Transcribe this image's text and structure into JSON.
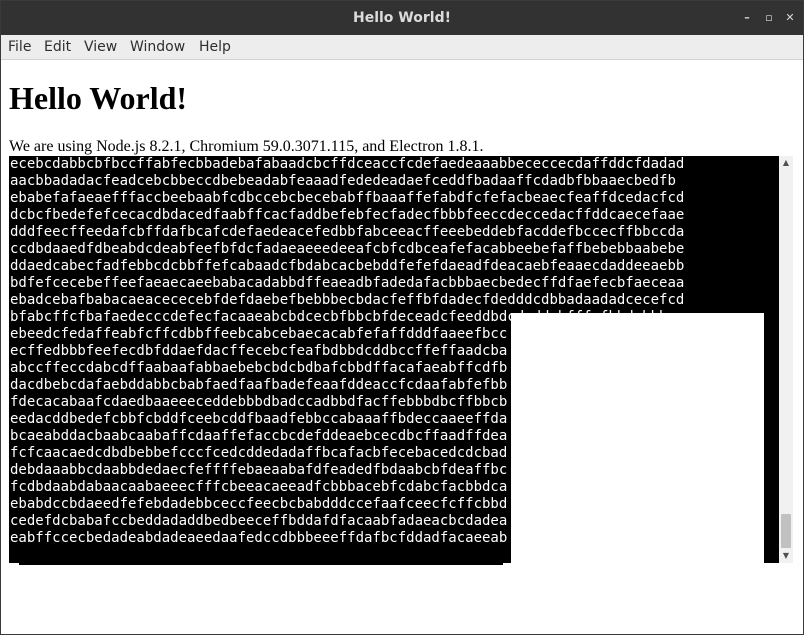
{
  "window": {
    "title": "Hello World!",
    "minimize_glyph": "–",
    "restore_glyph": "▫",
    "close_glyph": "✕"
  },
  "menu": {
    "items": [
      "File",
      "Edit",
      "View",
      "Window",
      "Help"
    ]
  },
  "page": {
    "heading": "Hello World!",
    "subtitle": "We are using Node.js 8.2.1, Chromium 59.0.3071.115, and Electron 1.8.1."
  },
  "textarea": {
    "lines": [
      "ecebcdabbcbfbccffabfecbbadebafabaadcbcffdceaccfcdefaedeaaabbececcecdaffddcfdadad",
      "aacbbadadacfeadcebcbbeccdbebeadabfeaaadfededeadaefceddfbadaaffcdadbfbbaaecbedfb",
      "ebabefafaeaefffaccbeebaabfcdbccebcbecebabffbaaaffefabdfcfefacbeaecfeaffdcedacfcd",
      "dcbcfbedefefcecacdbdacedfaabffcacfaddbefebfecfadecfbbbfeeccdeccedacffddcaecefaae",
      "dddfeecffeedafcbffdafbcafcdefaedeacefedbbfabceeacffeeebeddebfacddefbccecffbbccda",
      "ccdbdaaedfdbeabdcdeabfeefbfdcfadaeaeeedeeafcbfcdbceafefacabbeebefaffbebebbaabebe",
      "ddaedcabecfadfebbcdcbbffefcabaadcfbdabcacbebddfefefdaeadfdeacaebfeaaecdaddeeaebb",
      "bdfefcecebeffeefaeaecaeebabacadabbdffeaeadbfadedafacbbbaecbedecffdfaefecbfaeceaa",
      "ebadcebafbabacaeacececebfdefdaebefbebbbecbdacfeffbfdadecfdedddcdbbadaadadcecefcd",
      "bfabcffcfbafaedecccdefecfacaaeabcbdcecbfbbcbfdeceadcfeeddbdcdaddcbfffcfbbdcbbbaa",
      "ebeedcfedaffeabfcffcdbbffeebcabcebaecacabfefaffdddfaaeefbcc",
      "ecffedbbbfeefecdbfddaefdacffecebcfeafbdbbdcddbccffeffaadcba",
      "abccffeccdabcdffaabaafabbaebebcbdcbdbafcbbdffacafaeabffcdfb",
      "dacdbebcdafaebddabbcbabfaedfaafbadefeaafddeaccfcdaafabfefbb",
      "fdecacabaafcdaedbaaeeeceddebbbdbadccadbbdfacffebbbdbcffbbcb",
      "eedacddbedefcbbfcbddfceebcddfbaadfebbccabaaaffbdeccaaeeffda",
      "bcaeabddacbaabcaabaffcdaaffefaccbcdefddeaebcecdbcffaadffdea",
      "fcfcaacaedcdbdbebbefcccfcedcddedadaffbcafacbfecebacedcdcbad",
      "debdaaabbcdaabbdedaecfeffffebaeaabafdfeadedfbdaabcbfdeaffbc",
      "fcdbdaabdabaacaabaeeecfffcbeeacaeeadfcbbbacebfcdabcfacbbdca",
      "ebabdccbdaeedfefebdadebbceccfeecbcbabdddccefaafceecfcffcbbd",
      "cedefdcbabafccbeddadaddbedbeeceffbddafdfacaabfadaeacbcdadea",
      "eabffccecbedadeabdadeaeedaafedccdbbbeeeffdafbcfddadfacaeeab"
    ]
  },
  "scrollbar": {
    "up_glyph": "▲",
    "down_glyph": "▼"
  }
}
